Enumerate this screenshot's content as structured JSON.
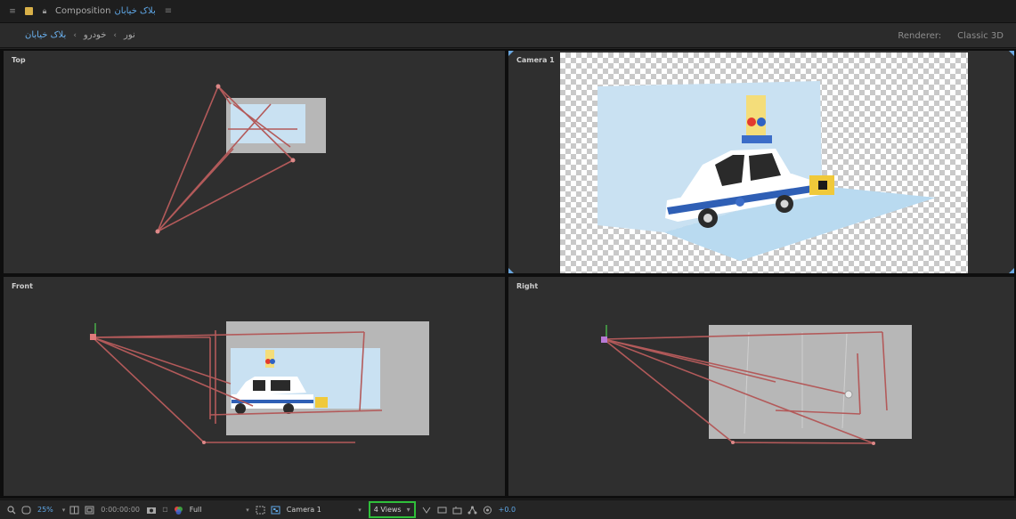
{
  "title_bar": {
    "panel_label": "Composition",
    "comp_name": "بلاک خیابان",
    "close_glyph": "≡"
  },
  "breadcrumbs": {
    "items": [
      "بلاک خیابان",
      "خودرو",
      "نور"
    ],
    "separator": "‹"
  },
  "header_right": {
    "renderer_label": "Renderer:",
    "renderer_value": "Classic 3D"
  },
  "views": {
    "top": {
      "label": "Top"
    },
    "camera": {
      "label": "Camera 1"
    },
    "front": {
      "label": "Front"
    },
    "right": {
      "label": "Right"
    }
  },
  "toolbar": {
    "zoom": "25%",
    "timecode": "0:00:00:00",
    "resolution": "Full",
    "active_camera": "Camera 1",
    "view_layout": "4 Views",
    "exposure": "+0.0",
    "icons": [
      "magnify-icon",
      "mask-icon",
      "grid-icon",
      "safe-zones-icon",
      "camera-snapshot-icon",
      "color-channel-icon",
      "region-of-interest-icon",
      "transparency-grid-icon",
      "fast-preview-icon",
      "timeline-icon",
      "comp-flowchart-icon",
      "exposure-reset-icon"
    ]
  },
  "colors": {
    "accent_blue": "#5fa8e8",
    "views_highlight": "#2fbf3a",
    "camera_wire": "#b35a5a",
    "sky_panel": "#c9e1f2",
    "ground_panel": "#b9daf0"
  }
}
